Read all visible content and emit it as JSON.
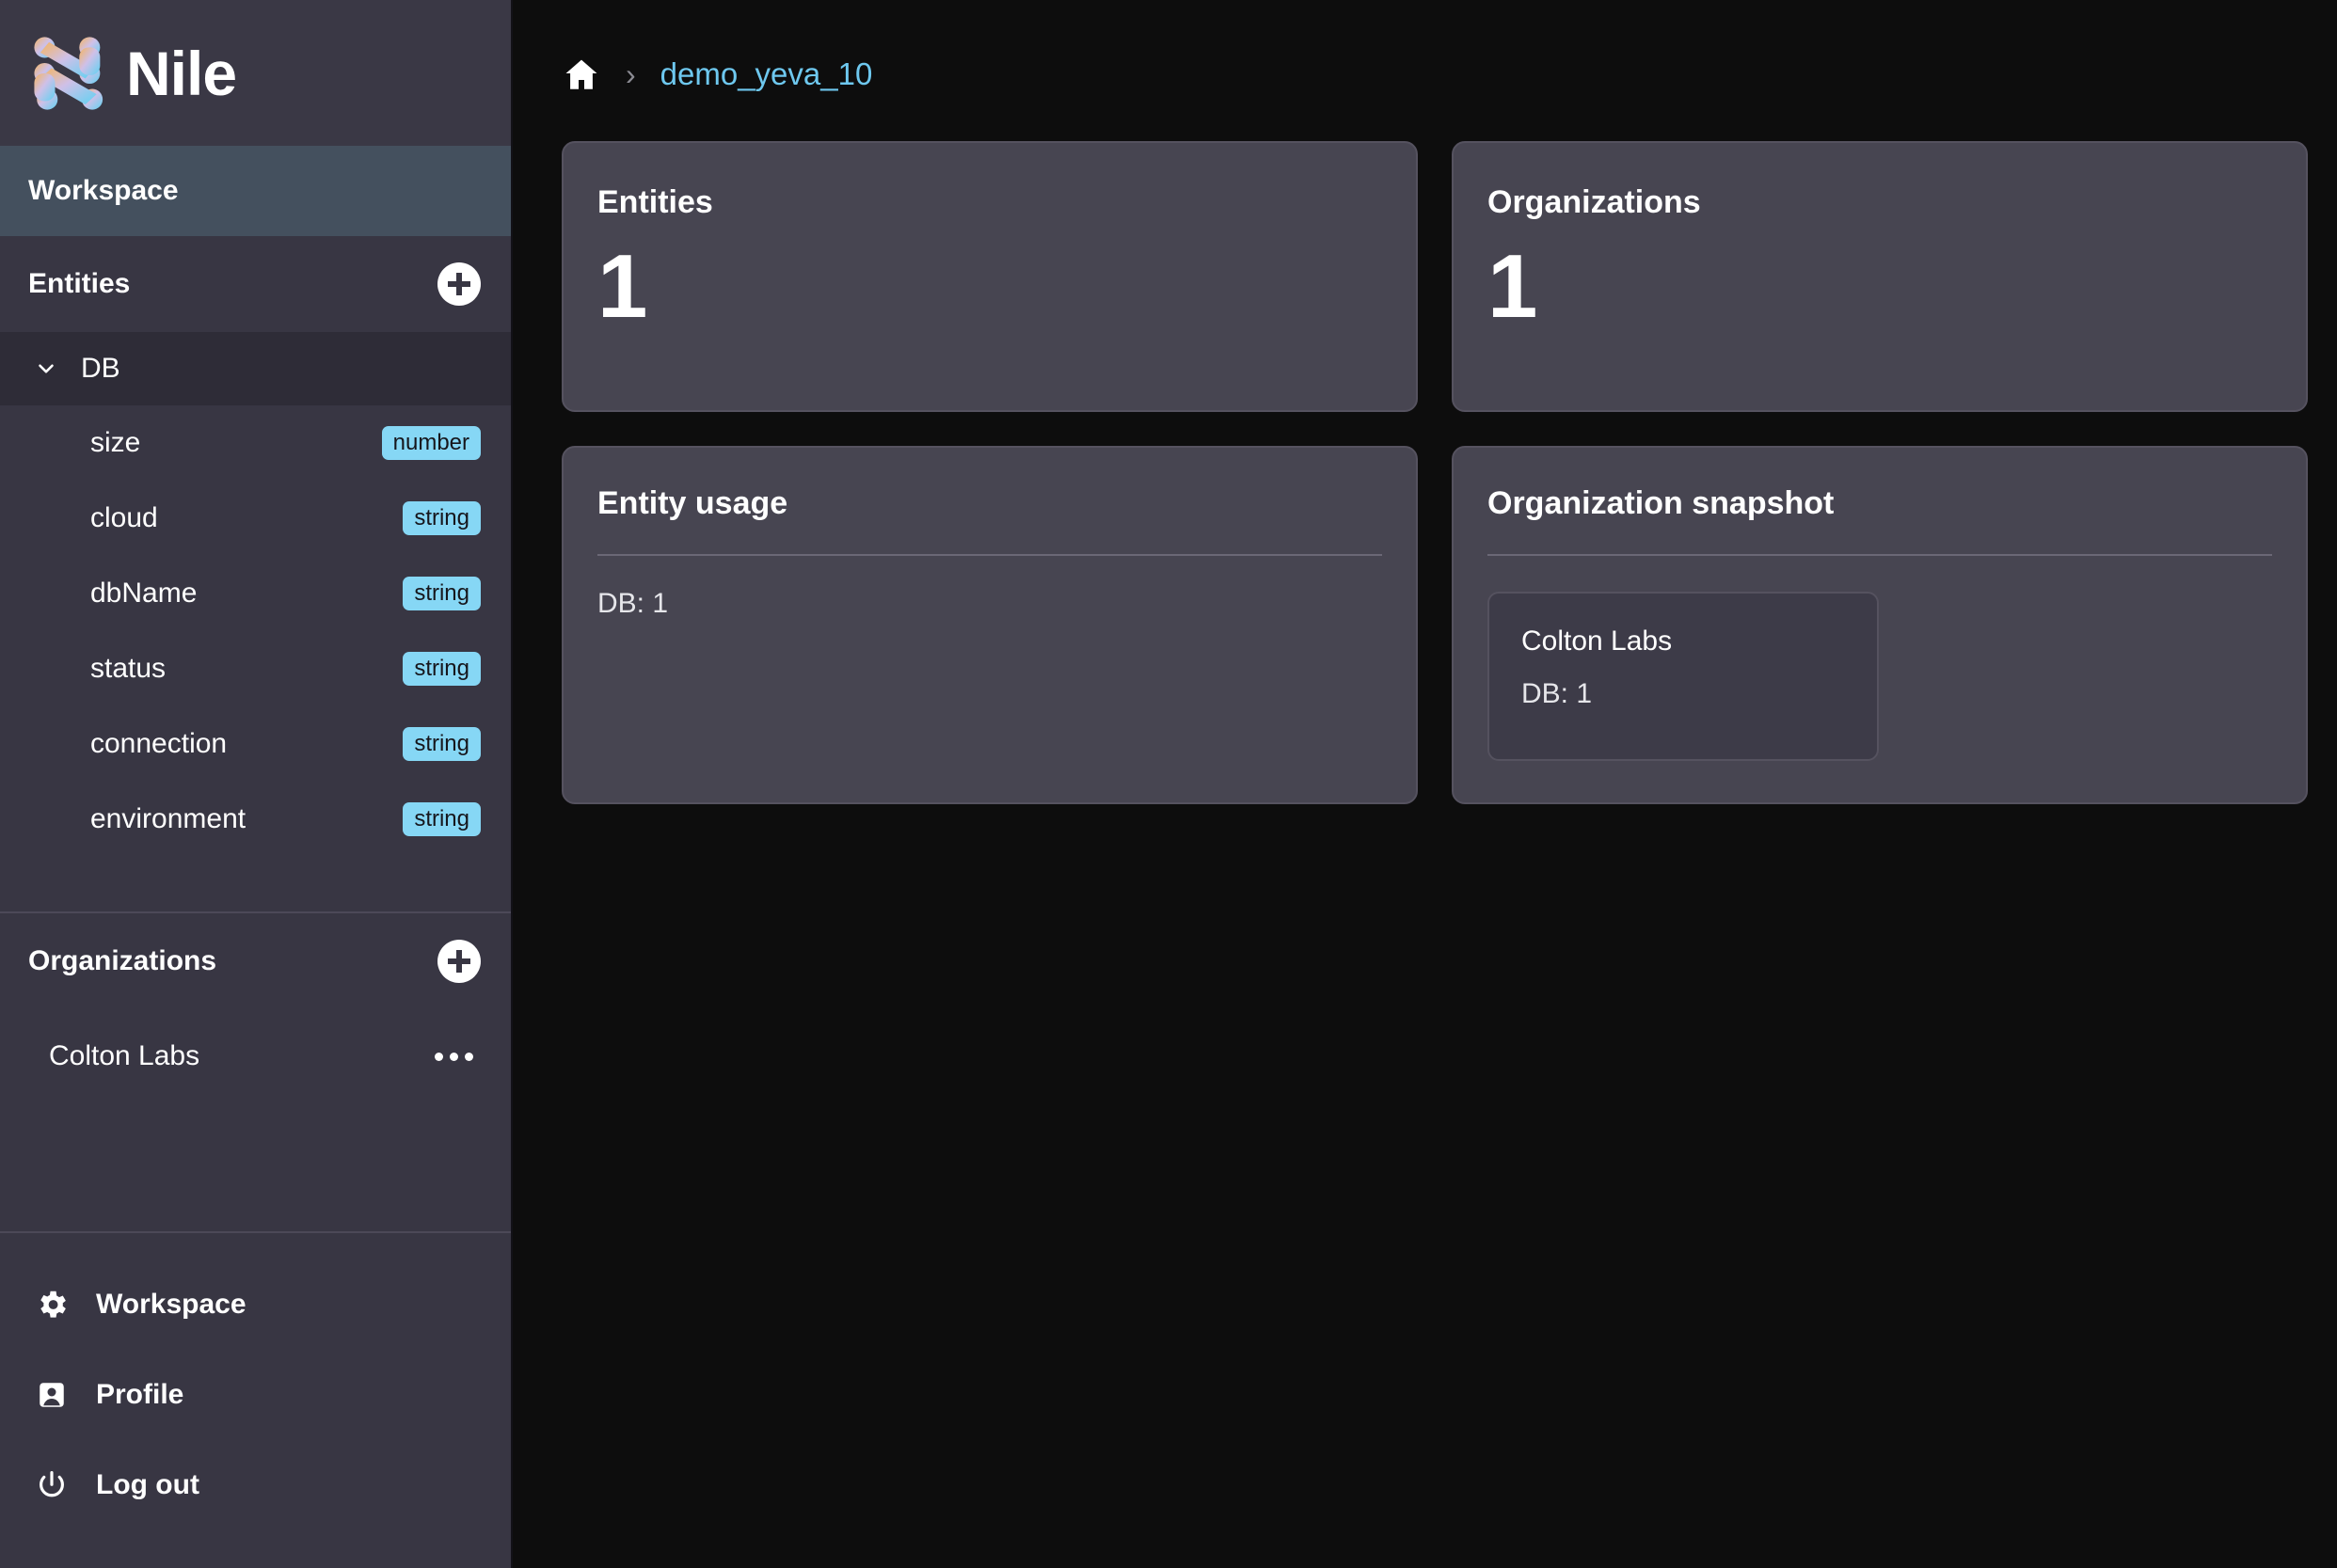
{
  "brand": {
    "name": "Nile",
    "logo_icon": "nile-logo-icon"
  },
  "sidebar": {
    "workspace_active": {
      "label": "Workspace"
    },
    "entities_section": {
      "title": "Entities",
      "add_icon": "plus-circle-icon"
    },
    "entity": {
      "name": "DB",
      "chevron_icon": "chevron-down-icon",
      "fields": [
        {
          "name": "size",
          "type": "number"
        },
        {
          "name": "cloud",
          "type": "string"
        },
        {
          "name": "dbName",
          "type": "string"
        },
        {
          "name": "status",
          "type": "string"
        },
        {
          "name": "connection",
          "type": "string"
        },
        {
          "name": "environment",
          "type": "string"
        }
      ]
    },
    "organizations_section": {
      "title": "Organizations",
      "add_icon": "plus-circle-icon"
    },
    "organizations": [
      {
        "name": "Colton Labs",
        "menu_icon": "ellipsis-icon"
      }
    ],
    "bottom_nav": [
      {
        "label": "Workspace",
        "icon": "gear-icon"
      },
      {
        "label": "Profile",
        "icon": "user-badge-icon"
      },
      {
        "label": "Log out",
        "icon": "power-icon"
      }
    ]
  },
  "breadcrumb": {
    "home_icon": "home-icon",
    "separator": "›",
    "current": "demo_yeva_10"
  },
  "main": {
    "stat_cards": [
      {
        "title": "Entities",
        "value": "1"
      },
      {
        "title": "Organizations",
        "value": "1"
      }
    ],
    "entity_usage": {
      "title": "Entity usage",
      "lines": [
        "DB: 1"
      ]
    },
    "organization_snapshot": {
      "title": "Organization snapshot",
      "orgs": [
        {
          "name": "Colton Labs",
          "line": "DB: 1"
        }
      ]
    }
  },
  "colors": {
    "sidebar_bg": "#383643",
    "sidebar_active": "#44505e",
    "entity_row_bg": "#2e2c37",
    "main_bg": "#0d0d0d",
    "card_bg": "#474551",
    "badge_bg": "#86d7f5",
    "link": "#6ec8ef"
  }
}
